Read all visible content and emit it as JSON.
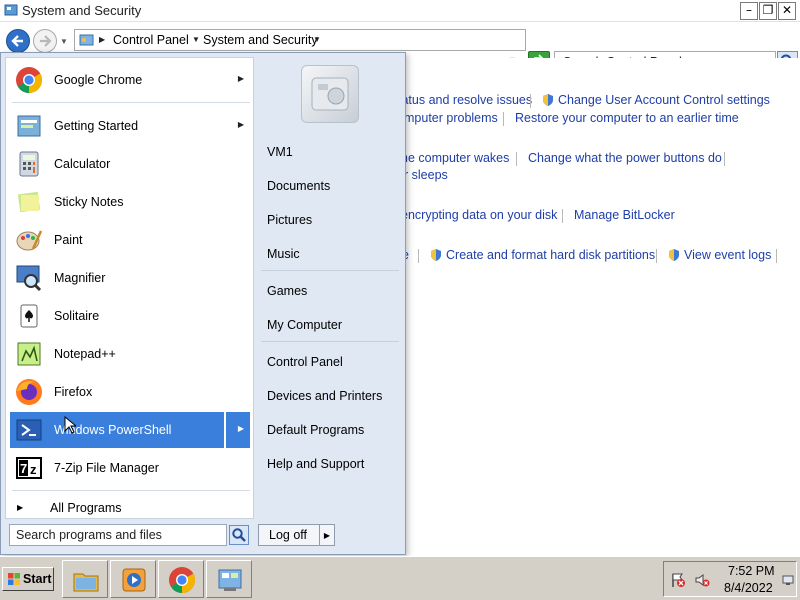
{
  "window": {
    "title": "System and Security",
    "min_glyph": "–",
    "max_glyph": "❐",
    "close_glyph": "✕"
  },
  "navbar": {
    "breadcrumb": [
      "Control Panel",
      "System and Security"
    ],
    "search_placeholder": "Search Control Panel"
  },
  "content": {
    "links": [
      "tatus and resolve issues",
      "Change User Account Control settings",
      "mputer problems",
      "Restore your computer to an earlier time",
      "he computer wakes",
      "Change what the power buttons do",
      "r sleeps",
      "encrypting data on your disk",
      "Manage BitLocker",
      "e",
      "Create and format hard disk partitions",
      "View event logs"
    ]
  },
  "start_menu": {
    "programs": [
      {
        "label": "Google Chrome",
        "icon": "chrome-icon",
        "has_submenu": true
      },
      {
        "label": "Getting Started",
        "icon": "getting-started-icon",
        "has_submenu": true
      },
      {
        "label": "Calculator",
        "icon": "calculator-icon",
        "has_submenu": false
      },
      {
        "label": "Sticky Notes",
        "icon": "sticky-notes-icon",
        "has_submenu": false
      },
      {
        "label": "Paint",
        "icon": "paint-icon",
        "has_submenu": false
      },
      {
        "label": "Magnifier",
        "icon": "magnifier-icon",
        "has_submenu": false
      },
      {
        "label": "Solitaire",
        "icon": "solitaire-icon",
        "has_submenu": false
      },
      {
        "label": "Notepad++",
        "icon": "notepadpp-icon",
        "has_submenu": false
      },
      {
        "label": "Firefox",
        "icon": "firefox-icon",
        "has_submenu": false
      },
      {
        "label": "Windows PowerShell",
        "icon": "powershell-icon",
        "has_submenu": true
      },
      {
        "label": "7-Zip File Manager",
        "icon": "7zip-icon",
        "has_submenu": false
      }
    ],
    "all_programs": "All Programs",
    "search_placeholder": "Search programs and files",
    "right_items": {
      "user": "VM1",
      "documents": "Documents",
      "pictures": "Pictures",
      "music": "Music",
      "games": "Games",
      "my_computer": "My Computer",
      "control_panel": "Control Panel",
      "devices_printers": "Devices and Printers",
      "default_programs": "Default Programs",
      "help_support": "Help and Support"
    },
    "log_off": "Log off"
  },
  "taskbar": {
    "start": "Start",
    "apps": [
      "explorer-icon",
      "media-player-icon",
      "chrome-icon",
      "control-panel-icon"
    ],
    "time": "7:52 PM",
    "date": "8/4/2022"
  },
  "colors": {
    "selection": "#3a7fdc",
    "link": "#1e3ea8",
    "taskbar": "#d4d0c8"
  }
}
